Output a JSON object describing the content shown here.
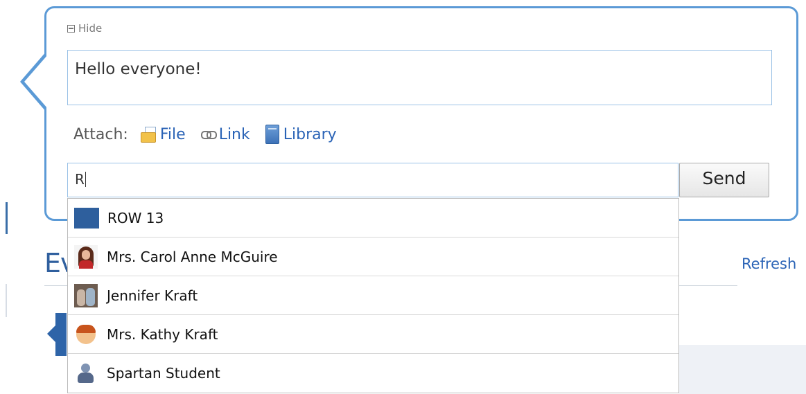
{
  "composer": {
    "hide_label": "Hide",
    "message_value": "Hello everyone!",
    "attach": {
      "label": "Attach:",
      "file_label": "File",
      "link_label": "Link",
      "library_label": "Library"
    },
    "recipient_value": "R",
    "send_label": "Send"
  },
  "suggestions": [
    {
      "label": "ROW 13",
      "icon": "group-square-icon"
    },
    {
      "label": "Mrs. Carol Anne McGuire",
      "icon": "user-photo-icon"
    },
    {
      "label": "Jennifer Kraft",
      "icon": "user-photo-icon"
    },
    {
      "label": "Mrs. Kathy Kraft",
      "icon": "user-avatar-icon"
    },
    {
      "label": "Spartan Student",
      "icon": "default-user-icon"
    }
  ],
  "background": {
    "heading_fragment": "Ev",
    "refresh_label": "Refresh"
  },
  "colors": {
    "accent": "#5b9ad6",
    "link": "#2a63b6",
    "brand_blue": "#2e5f9d"
  }
}
